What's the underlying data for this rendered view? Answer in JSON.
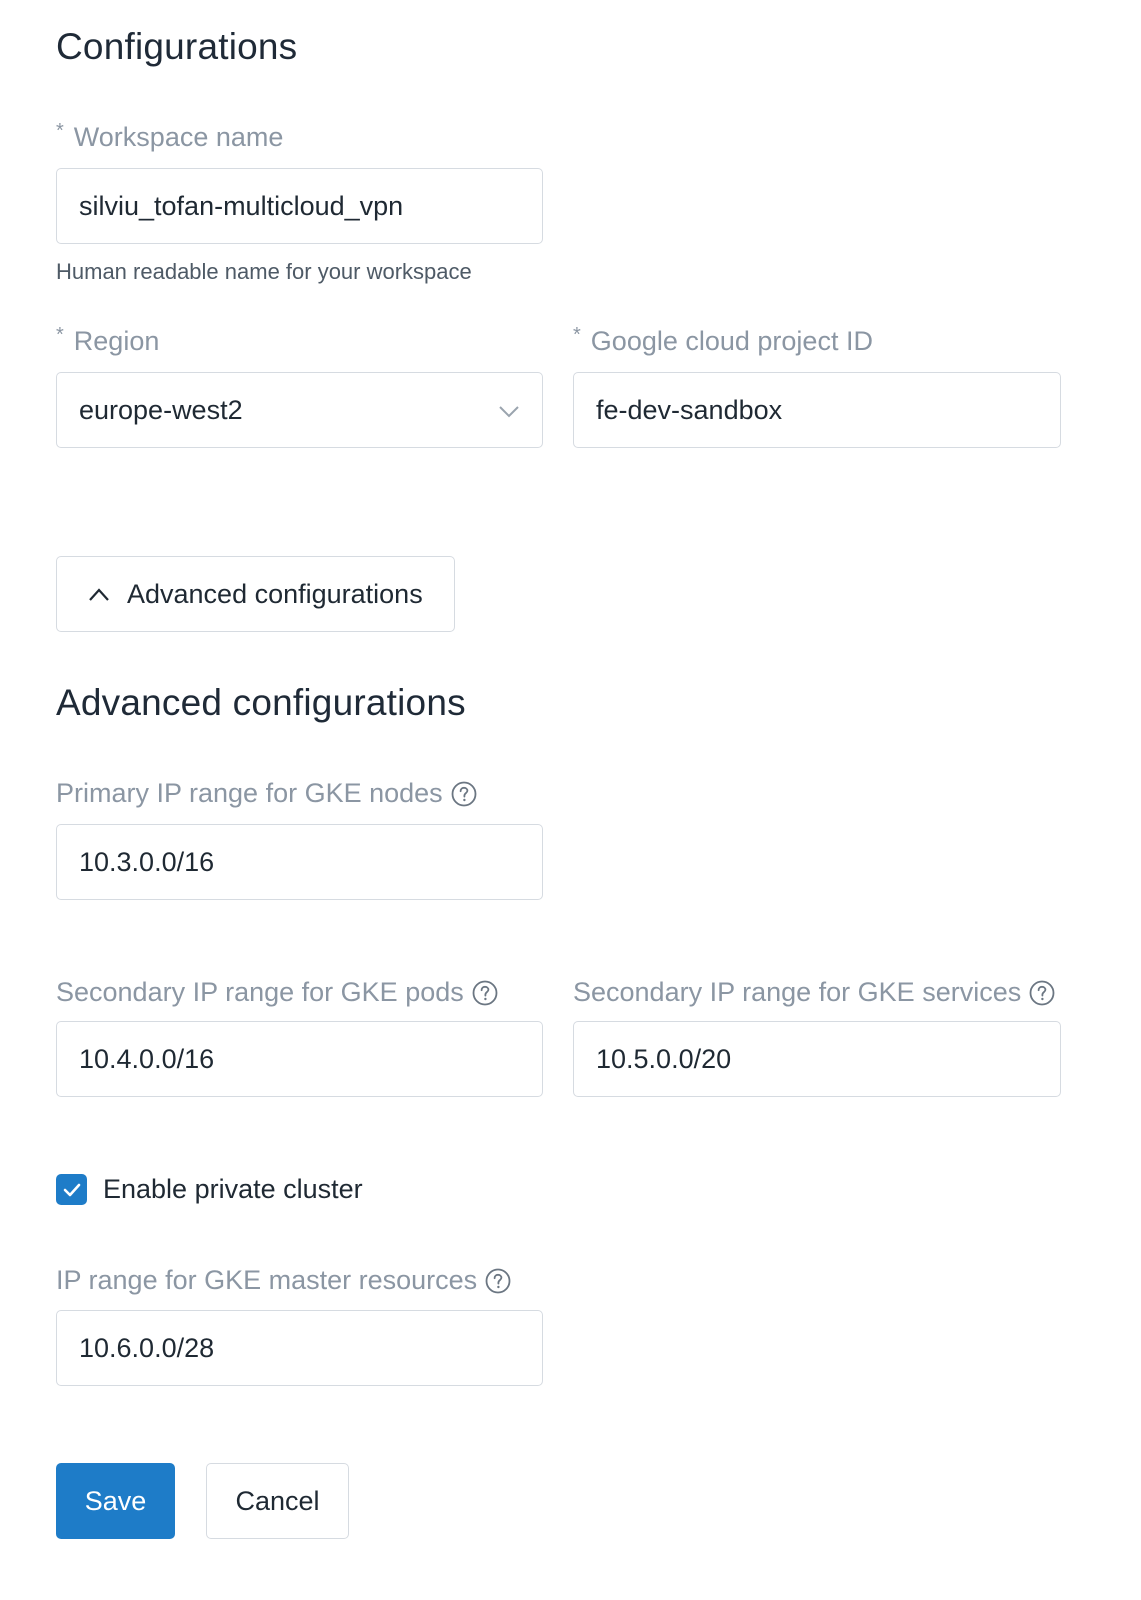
{
  "configurations": {
    "title": "Configurations",
    "required_marker": "*",
    "workspace_name": {
      "label": "Workspace name",
      "value": "silviu_tofan-multicloud_vpn",
      "help": "Human readable name for your workspace"
    },
    "region": {
      "label": "Region",
      "value": "europe-west2"
    },
    "project_id": {
      "label": "Google cloud project ID",
      "value": "fe-dev-sandbox"
    }
  },
  "advanced_toggle": {
    "label": "Advanced configurations",
    "icon": "chevron-up-icon"
  },
  "advanced": {
    "title": "Advanced configurations",
    "primary_ip_range": {
      "label": "Primary IP range for GKE nodes",
      "value": "10.3.0.0/16"
    },
    "pods_ip_range": {
      "label": "Secondary IP range for GKE pods",
      "value": "10.4.0.0/16"
    },
    "services_ip_range": {
      "label": "Secondary IP range for GKE services",
      "value": "10.5.0.0/20"
    },
    "private_cluster": {
      "label": "Enable private cluster",
      "checked": true
    },
    "master_ip_range": {
      "label": "IP range for GKE master resources",
      "value": "10.6.0.0/28"
    }
  },
  "actions": {
    "save_label": "Save",
    "cancel_label": "Cancel"
  },
  "colors": {
    "primary": "#1e7cc8",
    "label": "#8b96a3",
    "border": "#d6dbe1",
    "text": "#1f2933"
  }
}
